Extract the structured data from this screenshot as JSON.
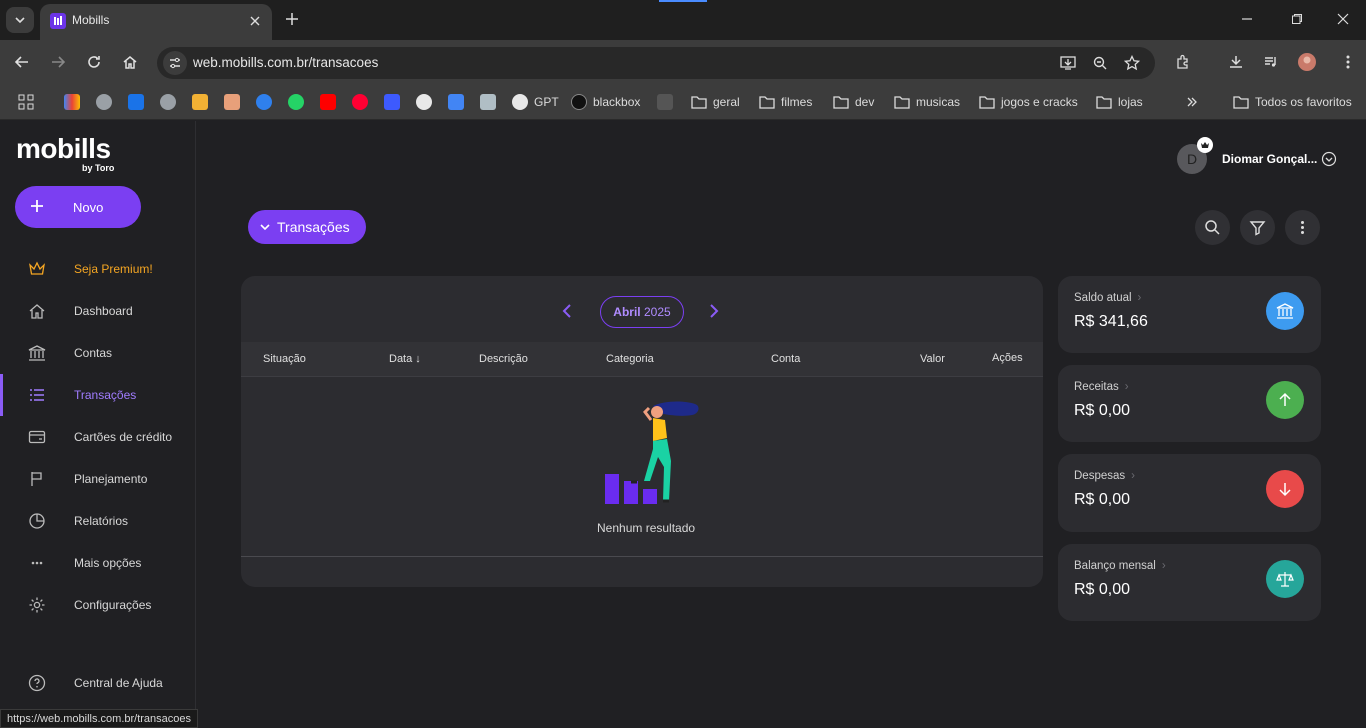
{
  "browser": {
    "tab_title": "Mobills",
    "url": "web.mobills.com.br/transacoes",
    "status_url": "https://web.mobills.com.br/transacoes",
    "bookmarks": {
      "gpt": "GPT",
      "blackbox": "blackbox",
      "geral": "geral",
      "filmes": "filmes",
      "dev": "dev",
      "musicas": "musicas",
      "jogos": "jogos e cracks",
      "lojas": "lojas",
      "all": "Todos os favoritos"
    }
  },
  "sidebar": {
    "logo": "mobills",
    "logo_sub": "by Toro",
    "new_button": "Novo",
    "items": [
      {
        "label": "Seja Premium!",
        "icon": "crown-icon"
      },
      {
        "label": "Dashboard",
        "icon": "home-icon"
      },
      {
        "label": "Contas",
        "icon": "bank-icon"
      },
      {
        "label": "Transações",
        "icon": "list-icon",
        "active": true
      },
      {
        "label": "Cartões de crédito",
        "icon": "card-icon"
      },
      {
        "label": "Planejamento",
        "icon": "flag-icon"
      },
      {
        "label": "Relatórios",
        "icon": "pie-icon"
      },
      {
        "label": "Mais opções",
        "icon": "more-icon"
      },
      {
        "label": "Configurações",
        "icon": "gear-icon"
      }
    ],
    "help": "Central de Ajuda"
  },
  "user": {
    "initial": "D",
    "name": "Diomar Gonçal..."
  },
  "main": {
    "view_button": "Transações",
    "month": {
      "name": "Abril",
      "year": "2025"
    },
    "columns": [
      "Situação",
      "Data ↓",
      "Descrição",
      "Categoria",
      "Conta",
      "Valor",
      "Ações"
    ],
    "empty_text": "Nenhum resultado"
  },
  "stats": [
    {
      "label": "Saldo atual",
      "value": "R$ 341,66",
      "color": "#3d9bf0",
      "icon": "bank-icon"
    },
    {
      "label": "Receitas",
      "value": "R$ 0,00",
      "color": "#4caf50",
      "icon": "arrow-up-icon"
    },
    {
      "label": "Despesas",
      "value": "R$ 0,00",
      "color": "#e84a4a",
      "icon": "arrow-down-icon"
    },
    {
      "label": "Balanço mensal",
      "value": "R$ 0,00",
      "color": "#26a69a",
      "icon": "scale-icon"
    }
  ],
  "colors": {
    "accent": "#7b3ff2",
    "premium": "#f5a623",
    "background": "#202023",
    "card": "#2c2c30"
  }
}
